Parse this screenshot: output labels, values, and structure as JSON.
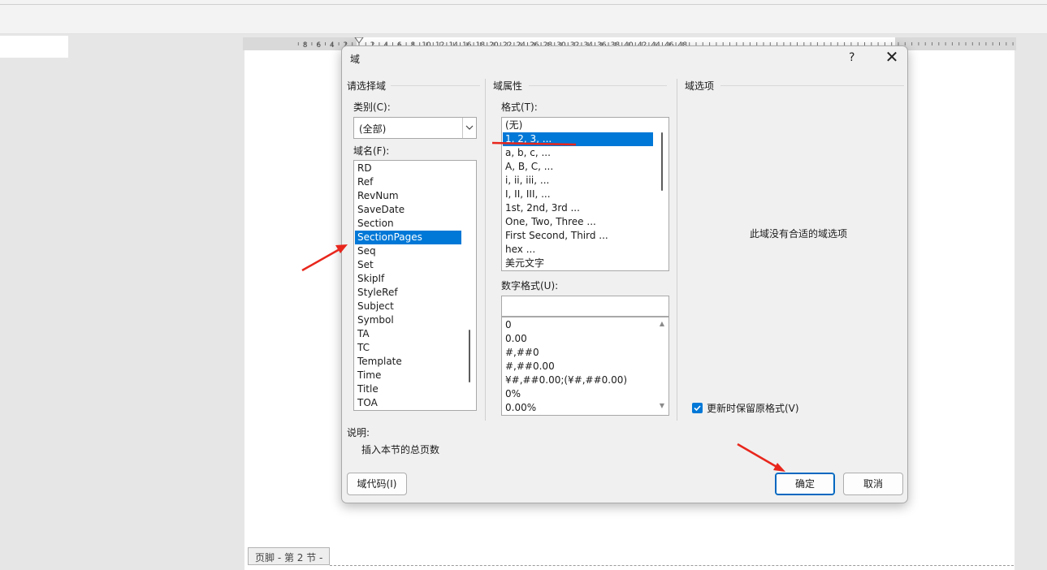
{
  "document": {
    "footer_tag": "页脚 - 第 2 节 -",
    "ruler_left_ticks": [
      "8",
      "6",
      "4",
      "2"
    ],
    "ruler_ticks": [
      "2",
      "4",
      "6",
      "8",
      "10",
      "12",
      "14",
      "16",
      "18",
      "20",
      "22",
      "24",
      "26",
      "28",
      "30",
      "32",
      "34",
      "36",
      "38",
      "40",
      "42",
      "44",
      "46",
      "48"
    ]
  },
  "dialog": {
    "title": "域",
    "help": "?",
    "close": "✕",
    "select_field": {
      "group_title": "请选择域",
      "category_label": "类别(C):",
      "category_value": "(全部)",
      "field_names_label": "域名(F):",
      "field_names": [
        "RD",
        "Ref",
        "RevNum",
        "SaveDate",
        "Section",
        "SectionPages",
        "Seq",
        "Set",
        "SkipIf",
        "StyleRef",
        "Subject",
        "Symbol",
        "TA",
        "TC",
        "Template",
        "Time",
        "Title",
        "TOA"
      ],
      "selected_field": "SectionPages"
    },
    "field_properties": {
      "group_title": "域属性",
      "format_label": "格式(T):",
      "formats": [
        "(无)",
        "1, 2, 3, ...",
        "a, b, c, ...",
        "A, B, C, ...",
        "i, ii, iii, ...",
        "I, II, III, ...",
        "1st, 2nd, 3rd ...",
        "One, Two, Three ...",
        "First Second, Third ...",
        "hex ...",
        "美元文字"
      ],
      "selected_format": "1, 2, 3, ...",
      "numeric_format_label": "数字格式(U):",
      "numeric_format_value": "",
      "numeric_formats": [
        "0",
        "0.00",
        "#,##0",
        "#,##0.00",
        "¥#,##0.00;(¥#,##0.00)",
        "0%",
        "0.00%"
      ]
    },
    "field_options": {
      "group_title": "域选项",
      "no_options_text": "此域没有合适的域选项",
      "preserve_format_label": "更新时保留原格式(V)",
      "preserve_format_checked": true
    },
    "description": {
      "label": "说明:",
      "text": "插入本节的总页数"
    },
    "buttons": {
      "field_codes": "域代码(I)",
      "ok": "确定",
      "cancel": "取消"
    }
  },
  "colors": {
    "selection": "#0078d7",
    "annotation": "#e8261c"
  }
}
